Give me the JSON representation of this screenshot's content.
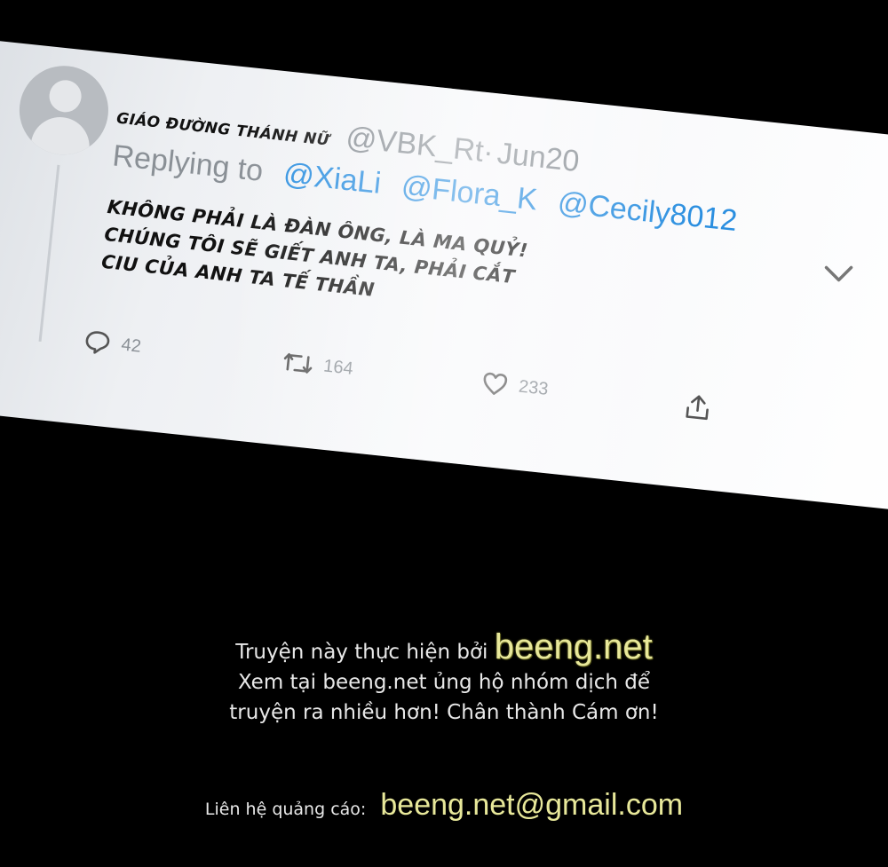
{
  "tweet": {
    "display_name": "GIÁO ĐƯỜNG THÁNH NỮ",
    "handle": "@VBK_Rt·",
    "date": "Jun20",
    "replying_label": "Replying to",
    "mentions": [
      "@XiaLi",
      "@Flora_K",
      "@Cecily8012"
    ],
    "body_lines": [
      "KHÔNG PHẢI LÀ ĐÀN ÔNG, LÀ MA QUỶ!",
      "CHÚNG TÔI SẼ GIẾT ANH TA, PHẢI CẮT",
      "CIU CỦA ANH TA TẾ THẦN"
    ],
    "stats": {
      "replies": "42",
      "retweets": "164",
      "likes": "233"
    },
    "icons": {
      "reply": "speech-bubble-icon",
      "retweet": "retweet-arrows-icon",
      "like": "heart-icon",
      "share": "share-upload-icon",
      "menu": "chevron-down-icon"
    },
    "colors": {
      "mention": "#2b8fe0",
      "meta": "#8a9096"
    }
  },
  "credits": {
    "line1_prefix": "Truyện này thực hiện bởi",
    "brand": "beeng.net",
    "line2": "Xem tại beeng.net ủng hộ nhóm dịch để",
    "line3": "truyện ra nhiều hơn! Chân thành Cám ơn!",
    "contact_label": "Liên hệ quảng cáo:",
    "contact_email": "beeng.net@gmail.com",
    "brand_color": "#e8e89a"
  }
}
